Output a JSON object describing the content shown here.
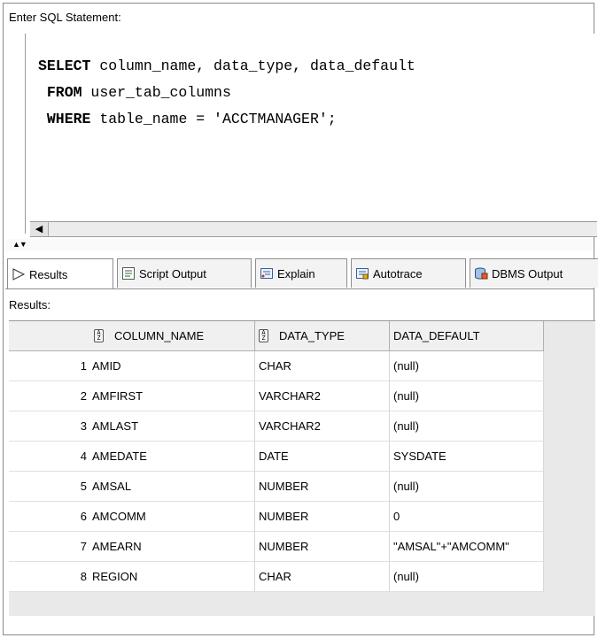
{
  "editor": {
    "label": "Enter SQL Statement:",
    "lines": [
      {
        "kw": "SELECT",
        "rest": " column_name, data_type, data_default"
      },
      {
        "kw": " FROM",
        "rest": " user_tab_columns"
      },
      {
        "kw": " WHERE",
        "rest": " table_name = 'ACCTMANAGER';"
      }
    ]
  },
  "tabs": [
    {
      "label": "Results",
      "icon": "play-triangle-icon"
    },
    {
      "label": "Script Output",
      "icon": "script-output-icon"
    },
    {
      "label": "Explain",
      "icon": "explain-plan-icon"
    },
    {
      "label": "Autotrace",
      "icon": "autotrace-icon"
    },
    {
      "label": "DBMS Output",
      "icon": "dbms-output-icon"
    }
  ],
  "results": {
    "label": "Results:",
    "columns": [
      "COLUMN_NAME",
      "DATA_TYPE",
      "DATA_DEFAULT"
    ],
    "rows": [
      {
        "num": "1",
        "column_name": "AMID",
        "data_type": "CHAR",
        "data_default": "(null)"
      },
      {
        "num": "2",
        "column_name": "AMFIRST",
        "data_type": "VARCHAR2",
        "data_default": "(null)"
      },
      {
        "num": "3",
        "column_name": "AMLAST",
        "data_type": "VARCHAR2",
        "data_default": "(null)"
      },
      {
        "num": "4",
        "column_name": "AMEDATE",
        "data_type": "DATE",
        "data_default": "SYSDATE"
      },
      {
        "num": "5",
        "column_name": "AMSAL",
        "data_type": "NUMBER",
        "data_default": "(null)"
      },
      {
        "num": "6",
        "column_name": "AMCOMM",
        "data_type": "NUMBER",
        "data_default": "0"
      },
      {
        "num": "7",
        "column_name": "AMEARN",
        "data_type": "NUMBER",
        "data_default": "\"AMSAL\"+\"AMCOMM\""
      },
      {
        "num": "8",
        "column_name": "REGION",
        "data_type": "CHAR",
        "data_default": "(null)"
      }
    ]
  }
}
